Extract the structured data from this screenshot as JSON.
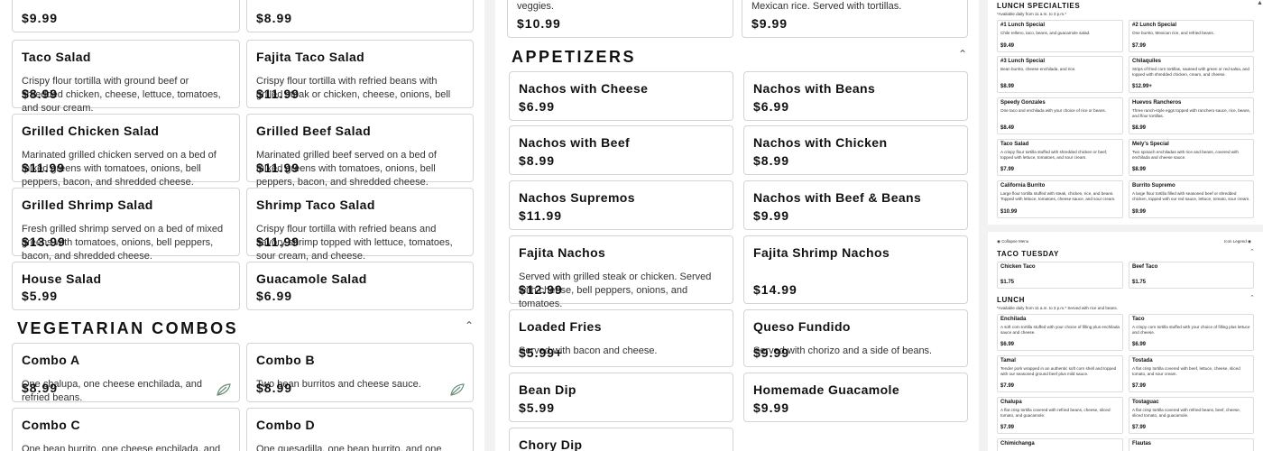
{
  "salads": {
    "cards": [
      {
        "title": "",
        "desc": "",
        "price": "$9.99"
      },
      {
        "title": "",
        "desc": "",
        "price": "$8.99"
      },
      {
        "title": "Taco Salad",
        "desc": "Crispy flour tortilla with ground beef or shredded chicken, cheese, lettuce, tomatoes, and sour cream.",
        "price": "$8.99"
      },
      {
        "title": "Fajita Taco Salad",
        "desc": "Crispy flour tortilla with refried beans with grilled steak or chicken, cheese, onions, bell peppers, tomatoes, lettuce, and sour cream.",
        "price": "$11.99"
      },
      {
        "title": "Grilled Chicken Salad",
        "desc": "Marinated grilled chicken served on a bed of mixed greens with tomatoes, onions, bell peppers, bacon, and shredded cheese.",
        "price": "$11.99"
      },
      {
        "title": "Grilled Beef Salad",
        "desc": "Marinated grilled beef served on a bed of mixed greens with tomatoes, onions, bell peppers, bacon, and shredded cheese.",
        "price": "$11.99"
      },
      {
        "title": "Grilled Shrimp Salad",
        "desc": "Fresh grilled shrimp served on a bed of mixed greens with tomatoes, onions, bell peppers, bacon, and shredded cheese.",
        "price": "$13.99"
      },
      {
        "title": "Shrimp Taco Salad",
        "desc": "Crispy flour tortilla with refried beans and savory shrimp topped with lettuce, tomatoes, sour cream, and cheese.",
        "price": "$11.99"
      },
      {
        "title": "House Salad",
        "desc": "",
        "price": "$5.99"
      },
      {
        "title": "Guacamole Salad",
        "desc": "",
        "price": "$6.99"
      }
    ]
  },
  "vegetarian": {
    "heading": "VEGETARIAN COMBOS",
    "cards": [
      {
        "title": "Combo A",
        "desc": "One chalupa, one cheese enchilada, and refried beans.",
        "price": "$8.99"
      },
      {
        "title": "Combo B",
        "desc": "Two bean burritos and cheese sauce.",
        "price": "$8.99"
      },
      {
        "title": "Combo C",
        "desc": "One bean burrito, one cheese enchilada, and one bean tostada.",
        "price": ""
      },
      {
        "title": "Combo D",
        "desc": "One quesadilla, one bean burrito, and one tostada.",
        "price": ""
      }
    ]
  },
  "appetizers": {
    "top_cards": [
      {
        "title": "",
        "desc": "veggies.",
        "price": "$10.99"
      },
      {
        "title": "",
        "desc": "Mexican rice. Served with tortillas.",
        "price": "$9.99"
      }
    ],
    "heading": "APPETIZERS",
    "cards": [
      {
        "title": "Nachos with Cheese",
        "desc": "",
        "price": "$6.99"
      },
      {
        "title": "Nachos with Beans",
        "desc": "",
        "price": "$6.99"
      },
      {
        "title": "Nachos with Beef",
        "desc": "",
        "price": "$8.99"
      },
      {
        "title": "Nachos with Chicken",
        "desc": "",
        "price": "$8.99"
      },
      {
        "title": "Nachos Supremos",
        "desc": "",
        "price": "$11.99"
      },
      {
        "title": "Nachos with Beef & Beans",
        "desc": "",
        "price": "$9.99"
      },
      {
        "title": "Fajita Nachos",
        "desc": "Served with grilled steak or chicken. Served with cheese, bell peppers, onions, and tomatoes.",
        "price": "$12.99"
      },
      {
        "title": "Fajita Shrimp Nachos",
        "desc": "",
        "price": "$14.99"
      },
      {
        "title": "Loaded Fries",
        "desc": "Served with bacon and cheese.",
        "price": "$5.99+"
      },
      {
        "title": "Queso Fundido",
        "desc": "Served with chorizo and a side of beans.",
        "price": "$9.99"
      },
      {
        "title": "Bean Dip",
        "desc": "",
        "price": "$5.99"
      },
      {
        "title": "Homemade Guacamole",
        "desc": "",
        "price": "$9.99"
      },
      {
        "title": "Chory Dip",
        "desc": "",
        "price": ""
      }
    ]
  },
  "right_panel": {
    "lunch_specials": {
      "heading": "LUNCH SPECIALTIES",
      "note": "*Available daily from 11 a.m. to 3 p.m.*",
      "items": [
        {
          "title": "#1 Lunch Special",
          "desc": "Chile relleno, taco, beans, and guacamole salad.",
          "price": "$9.49"
        },
        {
          "title": "#2 Lunch Special",
          "desc": "One burrito, Mexican rice, and refried beans.",
          "price": "$7.99"
        },
        {
          "title": "#3 Lunch Special",
          "desc": "Bean burrito, cheese enchilada, and rice.",
          "price": "$8.99"
        },
        {
          "title": "Chilaquiles",
          "desc": "Strips of fried corn tortillas, sauteed with green or red salsa, and topped with shredded chicken, cream, and cheese.",
          "price": "$12.99+"
        },
        {
          "title": "Speedy Gonzales",
          "desc": "One taco and enchilada with your choice of rice or beans.",
          "price": "$8.49"
        },
        {
          "title": "Huevos Rancheros",
          "desc": "Three ranch-style eggs topped with ranchero sauce, rice, beans, and flour tortillas.",
          "price": "$8.99"
        },
        {
          "title": "Taco Salad",
          "desc": "A crispy flour tortilla stuffed with shredded chicken or beef, topped with lettuce, tomatoes, and sour cream.",
          "price": "$7.99"
        },
        {
          "title": "Mely's Special",
          "desc": "Two spinach enchiladas with rice and beans, covered with enchilada and cheese sauce.",
          "price": "$8.99"
        },
        {
          "title": "California Burrito",
          "desc": "Large flour tortilla stuffed with steak, chicken, rice, and beans. Topped with lettuce, tomatoes, cheese sauce, and sour cream.",
          "price": "$10.99"
        },
        {
          "title": "Burrito Supremo",
          "desc": "A large flour tortilla filled with seasoned beef or shredded chicken, topped with our red sauce, lettuce, tomato, sour cream.",
          "price": "$9.99"
        }
      ]
    },
    "collapse_label": "Collapse Menu",
    "legend_label": "Icon Legend",
    "taco_tuesday": {
      "heading": "TACO TUESDAY",
      "items": [
        {
          "title": "Chicken Taco",
          "price": "$1.75"
        },
        {
          "title": "Beef Taco",
          "price": "$1.75"
        }
      ]
    },
    "lunch": {
      "heading": "LUNCH",
      "note": "*Available daily from 11 a.m. to 3 p.m.* Served with rice and beans.",
      "items": [
        {
          "title": "Enchilada",
          "desc": "A soft corn tortilla stuffed with your choice of filling plus enchilada sauce and cheese.",
          "price": "$6.99"
        },
        {
          "title": "Taco",
          "desc": "A crispy corn tortilla stuffed with your choice of filling plus lettuce and cheese.",
          "price": "$6.99"
        },
        {
          "title": "Tamal",
          "desc": "Tender pork wrapped in an authentic soft corn shell and topped with our seasoned ground beef plus mild sauce.",
          "price": "$7.99"
        },
        {
          "title": "Tostada",
          "desc": "A flat crisp tortilla covered with beef, lettuce, cheese, sliced tomato, and sour cream.",
          "price": "$7.99"
        },
        {
          "title": "Chalupa",
          "desc": "A flat crisp tortilla covered with refried beans, cheese, sliced tomato, and guacamole.",
          "price": "$7.99"
        },
        {
          "title": "Tostaguac",
          "desc": "A flat crisp tortilla covered with refried beans, beef, cheese, sliced tomato, and guacamole.",
          "price": "$7.99"
        },
        {
          "title": "Chimichanga",
          "desc": "",
          "price": ""
        },
        {
          "title": "Flautas",
          "desc": "",
          "price": ""
        }
      ]
    }
  }
}
